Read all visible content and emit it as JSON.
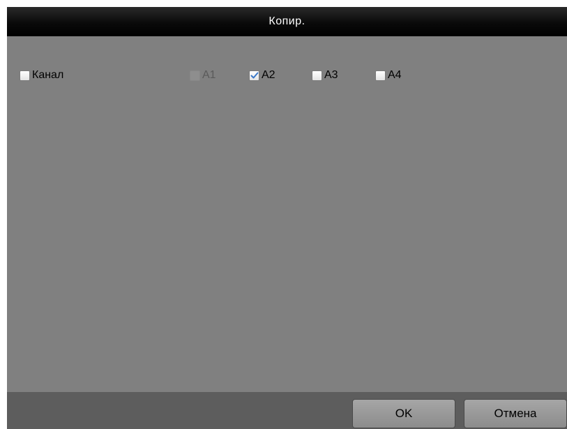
{
  "dialog": {
    "title": "Копир."
  },
  "checkboxes": {
    "channel": {
      "label": "Канал",
      "checked": false,
      "enabled": true
    },
    "a1": {
      "label": "A1",
      "checked": false,
      "enabled": false
    },
    "a2": {
      "label": "A2",
      "checked": true,
      "enabled": true
    },
    "a3": {
      "label": "A3",
      "checked": false,
      "enabled": true
    },
    "a4": {
      "label": "A4",
      "checked": false,
      "enabled": true
    }
  },
  "buttons": {
    "ok_label": "OK",
    "cancel_label": "Отмена"
  },
  "colors": {
    "check_mark": "#3a78c8",
    "panel": "#808080",
    "title_bar": "#0a0a0a",
    "footer": "#5d5d5d"
  }
}
